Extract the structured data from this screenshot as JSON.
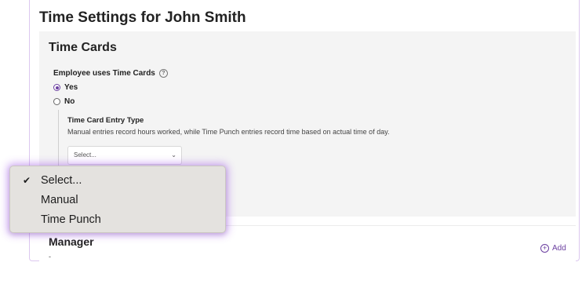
{
  "page": {
    "title": "Time Settings for John Smith"
  },
  "time_cards": {
    "section_title": "Time Cards",
    "question": "Employee uses Time Cards",
    "options": [
      {
        "label": "Yes",
        "checked": true
      },
      {
        "label": "No",
        "checked": false
      }
    ],
    "entry_type": {
      "label": "Time Card Entry Type",
      "description": "Manual entries record hours worked, while Time Punch entries record time based on actual time of day.",
      "selected": "Select...",
      "options": [
        "Select...",
        "Manual",
        "Time Punch"
      ]
    }
  },
  "manager": {
    "title": "Manager",
    "value": "-",
    "add_label": "Add"
  },
  "colors": {
    "accent": "#6b3fa0",
    "dropdown_glow": "#9d50eb"
  },
  "icons": {
    "help": "help-circle-icon",
    "check": "checkmark-icon",
    "chevron": "chevron-down-icon",
    "add": "plus-circle-icon"
  }
}
